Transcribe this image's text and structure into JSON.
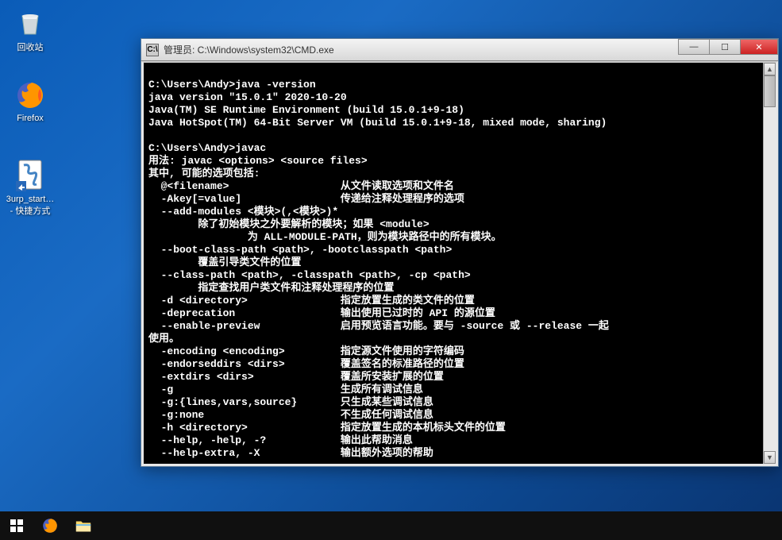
{
  "desktop": {
    "icons": [
      {
        "name": "recycle-bin",
        "label": "回收站"
      },
      {
        "name": "firefox",
        "label": "Firefox"
      },
      {
        "name": "burp",
        "label": "3urp_start…\n- 快捷方式"
      }
    ]
  },
  "window": {
    "title": "管理员: C:\\Windows\\system32\\CMD.exe",
    "icon_char": "C:\\",
    "buttons": {
      "min": "—",
      "max": "☐",
      "close": "✕"
    }
  },
  "terminal": {
    "lines": [
      "",
      "C:\\Users\\Andy>java -version",
      "java version \"15.0.1\" 2020-10-20",
      "Java(TM) SE Runtime Environment (build 15.0.1+9-18)",
      "Java HotSpot(TM) 64-Bit Server VM (build 15.0.1+9-18, mixed mode, sharing)",
      "",
      "C:\\Users\\Andy>javac",
      "用法: javac <options> <source files>",
      "其中, 可能的选项包括:",
      "  @<filename>                  从文件读取选项和文件名",
      "  -Akey[=value]                传递给注释处理程序的选项",
      "  --add-modules <模块>(,<模块>)*",
      "        除了初始模块之外要解析的模块；如果 <module>",
      "                为 ALL-MODULE-PATH，则为模块路径中的所有模块。",
      "  --boot-class-path <path>, -bootclasspath <path>",
      "        覆盖引导类文件的位置",
      "  --class-path <path>, -classpath <path>, -cp <path>",
      "        指定查找用户类文件和注释处理程序的位置",
      "  -d <directory>               指定放置生成的类文件的位置",
      "  -deprecation                 输出使用已过时的 API 的源位置",
      "  --enable-preview             启用预览语言功能。要与 -source 或 --release 一起",
      "使用。",
      "  -encoding <encoding>         指定源文件使用的字符编码",
      "  -endorseddirs <dirs>         覆盖签名的标准路径的位置",
      "  -extdirs <dirs>              覆盖所安装扩展的位置",
      "  -g                           生成所有调试信息",
      "  -g:{lines,vars,source}       只生成某些调试信息",
      "  -g:none                      不生成任何调试信息",
      "  -h <directory>               指定放置生成的本机标头文件的位置",
      "  --help, -help, -?            输出此帮助消息",
      "  --help-extra, -X             输出额外选项的帮助"
    ]
  },
  "taskbar": {
    "items": [
      "start",
      "firefox",
      "file-explorer"
    ]
  }
}
